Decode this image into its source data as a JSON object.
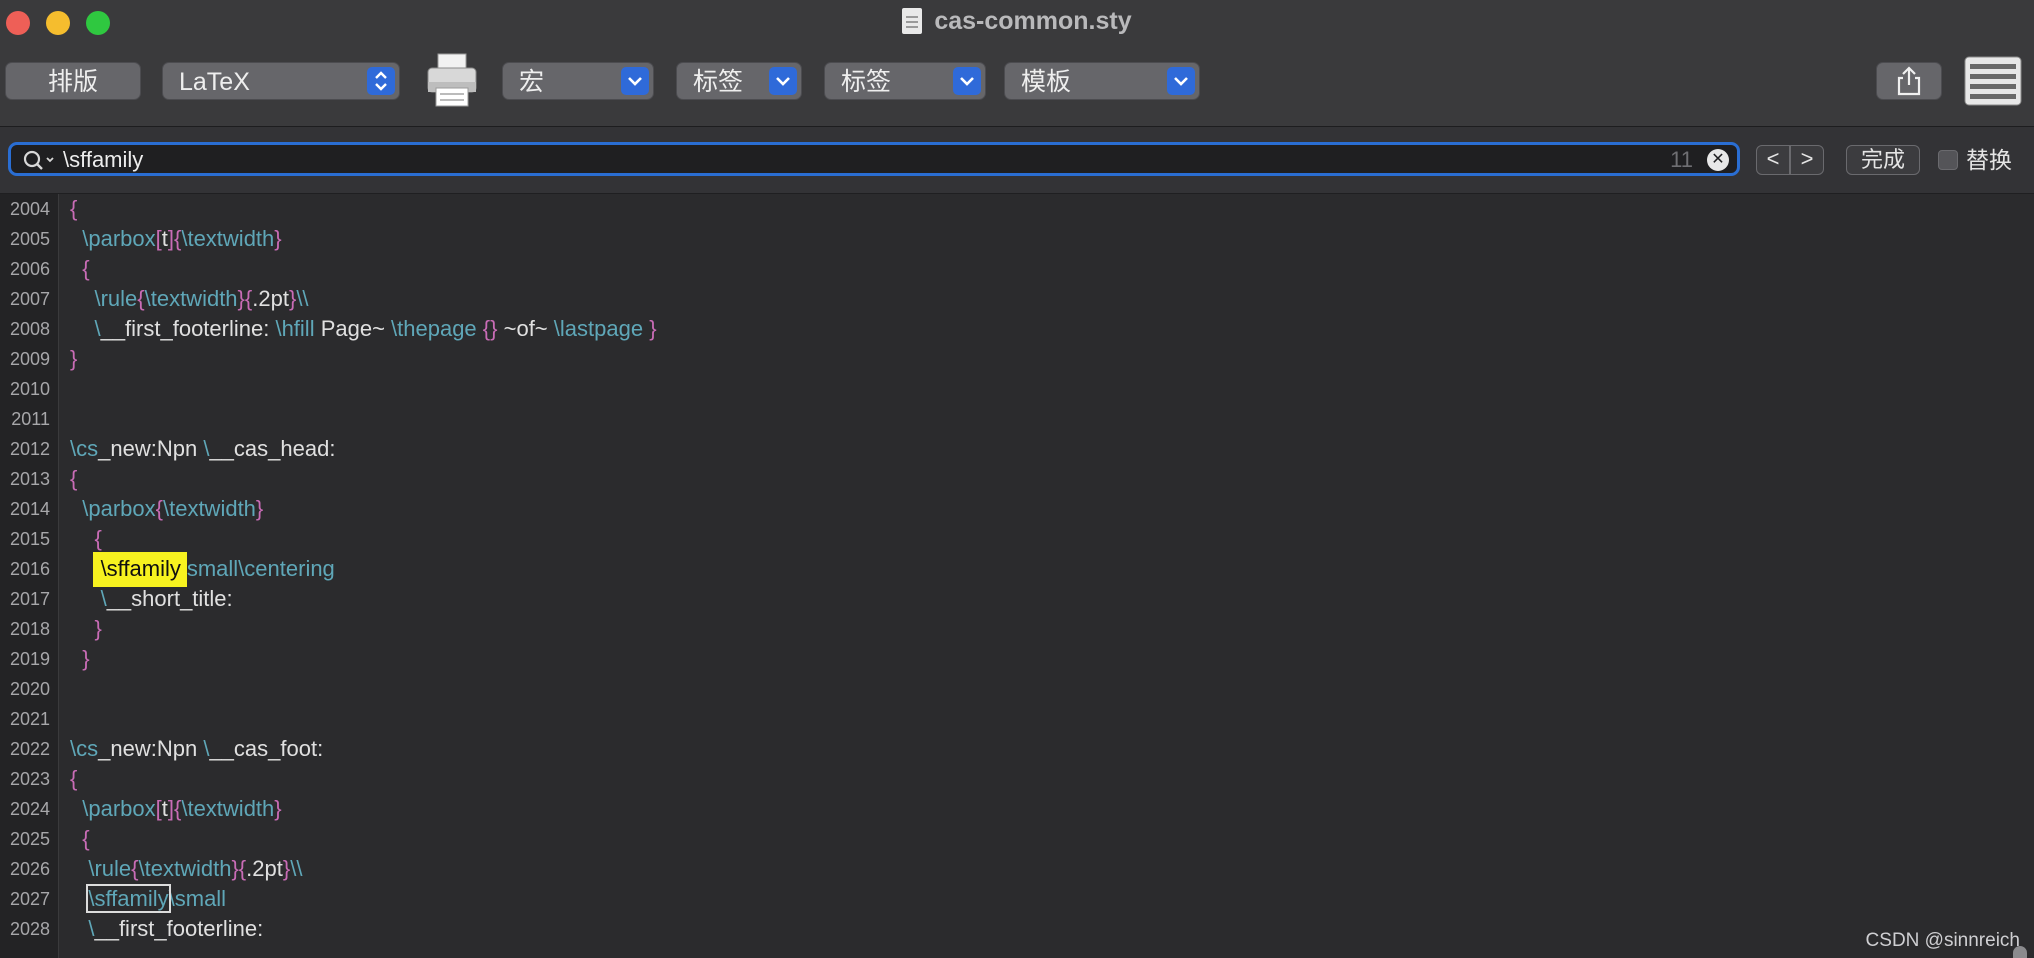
{
  "window": {
    "title": "cas-common.sty"
  },
  "toolbar": {
    "typeset_label": "排版",
    "engine_value": "LaTeX",
    "macro_label": "宏",
    "tags1_label": "标签",
    "tags2_label": "标签",
    "template_label": "模板"
  },
  "findbar": {
    "search_value": "\\sffamily",
    "match_count": "11",
    "prev_label": "<",
    "next_label": ">",
    "done_label": "完成",
    "replace_label": "替换"
  },
  "editor": {
    "lines": [
      {
        "n": "2004",
        "segs": [
          [
            "br",
            "{"
          ]
        ]
      },
      {
        "n": "2005",
        "segs": [
          [
            "txt",
            "  "
          ],
          [
            "cmd",
            "\\parbox"
          ],
          [
            "br",
            "["
          ],
          [
            "txt",
            "t"
          ],
          [
            "br",
            "]{"
          ],
          [
            "cmd",
            "\\textwidth"
          ],
          [
            "br",
            "}"
          ]
        ]
      },
      {
        "n": "2006",
        "segs": [
          [
            "txt",
            "  "
          ],
          [
            "br",
            "{"
          ]
        ]
      },
      {
        "n": "2007",
        "segs": [
          [
            "txt",
            "    "
          ],
          [
            "cmd",
            "\\rule"
          ],
          [
            "br",
            "{"
          ],
          [
            "cmd",
            "\\textwidth"
          ],
          [
            "br",
            "}{"
          ],
          [
            "txt",
            ".2pt"
          ],
          [
            "br",
            "}"
          ],
          [
            "cmd",
            "\\\\"
          ]
        ]
      },
      {
        "n": "2008",
        "segs": [
          [
            "txt",
            "    "
          ],
          [
            "cmd",
            "\\"
          ],
          [
            "txt",
            "__first_footerline: "
          ],
          [
            "cmd",
            "\\hfill"
          ],
          [
            "txt",
            " Page~ "
          ],
          [
            "cmd",
            "\\thepage"
          ],
          [
            "txt",
            " "
          ],
          [
            "br",
            "{}"
          ],
          [
            "txt",
            " ~of~ "
          ],
          [
            "cmd",
            "\\lastpage"
          ],
          [
            "txt",
            " "
          ],
          [
            "br",
            "}"
          ]
        ]
      },
      {
        "n": "2009",
        "segs": [
          [
            "br",
            "}"
          ]
        ]
      },
      {
        "n": "2010",
        "segs": []
      },
      {
        "n": "2011",
        "segs": []
      },
      {
        "n": "2012",
        "segs": [
          [
            "cmd",
            "\\cs"
          ],
          [
            "txt",
            "_new:Npn "
          ],
          [
            "cmd",
            "\\"
          ],
          [
            "txt",
            "__cas_head:"
          ]
        ]
      },
      {
        "n": "2013",
        "segs": [
          [
            "br",
            "{"
          ]
        ]
      },
      {
        "n": "2014",
        "segs": [
          [
            "txt",
            "  "
          ],
          [
            "cmd",
            "\\parbox"
          ],
          [
            "br",
            "{"
          ],
          [
            "cmd",
            "\\textwidth"
          ],
          [
            "br",
            "}"
          ]
        ]
      },
      {
        "n": "2015",
        "segs": [
          [
            "txt",
            "    "
          ],
          [
            "br",
            "{"
          ]
        ]
      },
      {
        "n": "2016",
        "segs": [
          [
            "txt",
            "     "
          ],
          [
            "hl",
            "\\sffamily"
          ],
          [
            "cmd",
            "small\\centering"
          ]
        ]
      },
      {
        "n": "2017",
        "segs": [
          [
            "txt",
            "     "
          ],
          [
            "cmd",
            "\\"
          ],
          [
            "txt",
            "__short_title:"
          ]
        ]
      },
      {
        "n": "2018",
        "segs": [
          [
            "txt",
            "    "
          ],
          [
            "br",
            "}"
          ]
        ]
      },
      {
        "n": "2019",
        "segs": [
          [
            "txt",
            "  "
          ],
          [
            "br",
            "}"
          ]
        ]
      },
      {
        "n": "2020",
        "segs": []
      },
      {
        "n": "2021",
        "segs": []
      },
      {
        "n": "2022",
        "segs": [
          [
            "cmd",
            "\\cs"
          ],
          [
            "txt",
            "_new:Npn "
          ],
          [
            "cmd",
            "\\"
          ],
          [
            "txt",
            "__cas_foot:"
          ]
        ]
      },
      {
        "n": "2023",
        "segs": [
          [
            "br",
            "{"
          ]
        ]
      },
      {
        "n": "2024",
        "segs": [
          [
            "txt",
            "  "
          ],
          [
            "cmd",
            "\\parbox"
          ],
          [
            "br",
            "["
          ],
          [
            "txt",
            "t"
          ],
          [
            "br",
            "]{"
          ],
          [
            "cmd",
            "\\textwidth"
          ],
          [
            "br",
            "}"
          ]
        ]
      },
      {
        "n": "2025",
        "segs": [
          [
            "txt",
            "  "
          ],
          [
            "br",
            "{"
          ]
        ]
      },
      {
        "n": "2026",
        "segs": [
          [
            "txt",
            "   "
          ],
          [
            "cmd",
            "\\rule"
          ],
          [
            "br",
            "{"
          ],
          [
            "cmd",
            "\\textwidth"
          ],
          [
            "br",
            "}{"
          ],
          [
            "txt",
            ".2pt"
          ],
          [
            "br",
            "}"
          ],
          [
            "cmd",
            "\\\\"
          ]
        ]
      },
      {
        "n": "2027",
        "segs": [
          [
            "txt",
            "   "
          ],
          [
            "box",
            "\\sffamily"
          ],
          [
            "cmd",
            "\\small"
          ]
        ]
      },
      {
        "n": "2028",
        "segs": [
          [
            "txt",
            "   "
          ],
          [
            "cmd",
            "\\"
          ],
          [
            "txt",
            "__first_footerline:"
          ]
        ]
      }
    ]
  },
  "watermark": "CSDN @sinnreich",
  "colors": {
    "accent": "#2f6ad9",
    "highlight": "#f7f21f",
    "command": "#5fa7b8",
    "brace": "#c96cb6"
  }
}
